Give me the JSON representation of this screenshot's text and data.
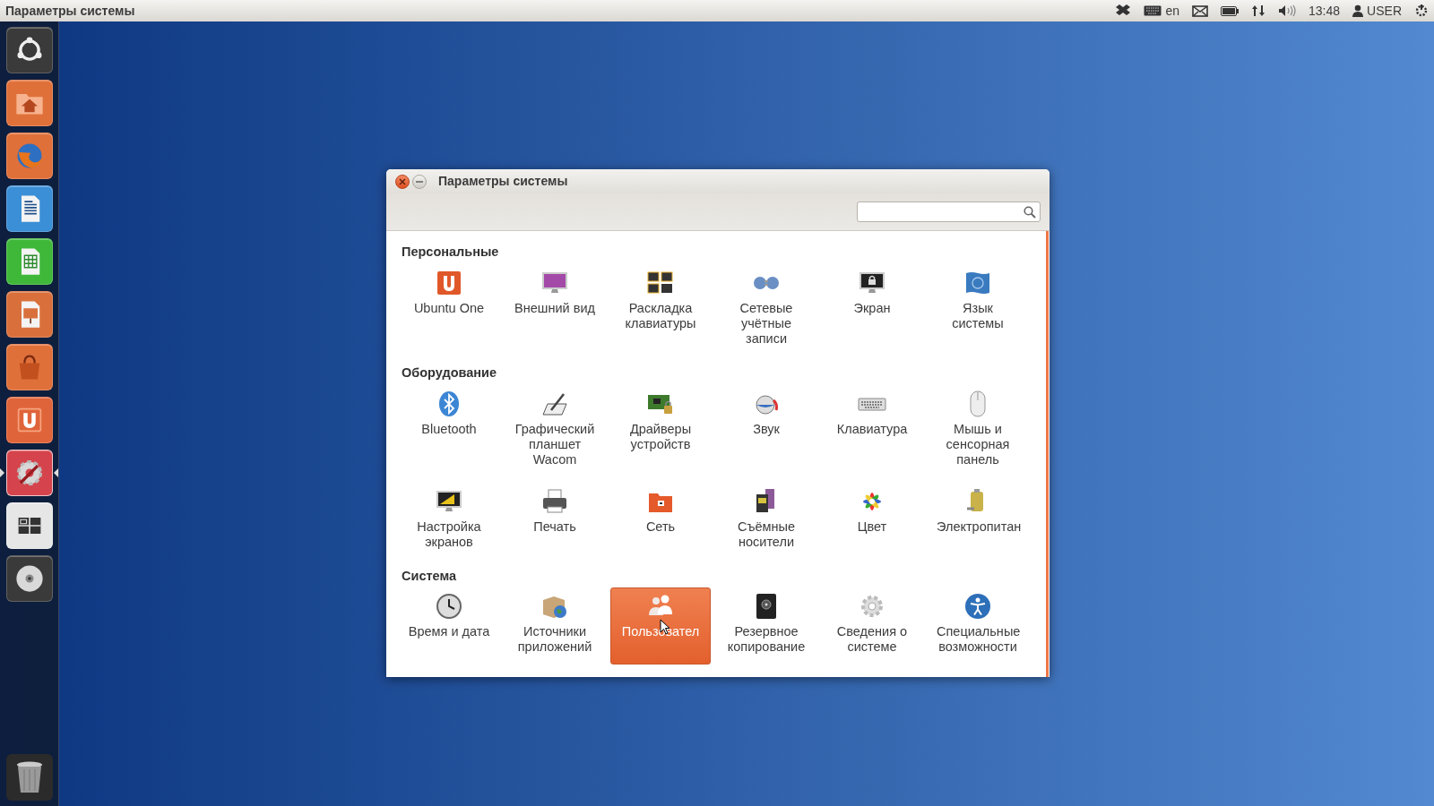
{
  "top_panel": {
    "title": "Параметры системы",
    "keyboard_layout": "en",
    "time": "13:48",
    "user": "USER"
  },
  "launcher": {
    "items": [
      {
        "color": "#3a3a3a",
        "active": false
      },
      {
        "color": "#e0703a",
        "active": false
      },
      {
        "color": "#e0703a",
        "active": false
      },
      {
        "color": "#3b8fd6",
        "active": false
      },
      {
        "color": "#3fb83a",
        "active": false
      },
      {
        "color": "#d9703c",
        "active": false
      },
      {
        "color": "#e0703a",
        "active": false
      },
      {
        "color": "#e0643a",
        "active": false
      },
      {
        "color": "#d5444c",
        "active": true
      },
      {
        "color": "#e6e6e6",
        "active": false
      },
      {
        "color": "#3a3a3a",
        "active": false
      }
    ]
  },
  "window": {
    "title": "Параметры системы",
    "sections": [
      {
        "title": "Персональные",
        "items": [
          {
            "label": "Ubuntu One",
            "selected": false
          },
          {
            "label": "Внешний вид",
            "selected": false
          },
          {
            "label": "Раскладка клавиатуры",
            "selected": false
          },
          {
            "label": "Сетевые учётные записи",
            "selected": false
          },
          {
            "label": "Экран",
            "selected": false
          },
          {
            "label": "Язык системы",
            "selected": false
          }
        ]
      },
      {
        "title": "Оборудование",
        "items": [
          {
            "label": "Bluetooth",
            "selected": false
          },
          {
            "label": "Графический планшет Wacom",
            "selected": false
          },
          {
            "label": "Драйверы устройств",
            "selected": false
          },
          {
            "label": "Звук",
            "selected": false
          },
          {
            "label": "Клавиатура",
            "selected": false
          },
          {
            "label": "Мышь и сенсорная панель",
            "selected": false
          },
          {
            "label": "Настройка экранов",
            "selected": false
          },
          {
            "label": "Печать",
            "selected": false
          },
          {
            "label": "Сеть",
            "selected": false
          },
          {
            "label": "Съёмные носители",
            "selected": false
          },
          {
            "label": "Цвет",
            "selected": false
          },
          {
            "label": "Электропитан",
            "selected": false
          }
        ]
      },
      {
        "title": "Система",
        "items": [
          {
            "label": "Время и дата",
            "selected": false
          },
          {
            "label": "Источники приложений",
            "selected": false
          },
          {
            "label": "Пользовател",
            "selected": true
          },
          {
            "label": "Резервное копирование",
            "selected": false
          },
          {
            "label": "Сведения о системе",
            "selected": false
          },
          {
            "label": "Специальные возможности",
            "selected": false
          }
        ]
      }
    ]
  }
}
